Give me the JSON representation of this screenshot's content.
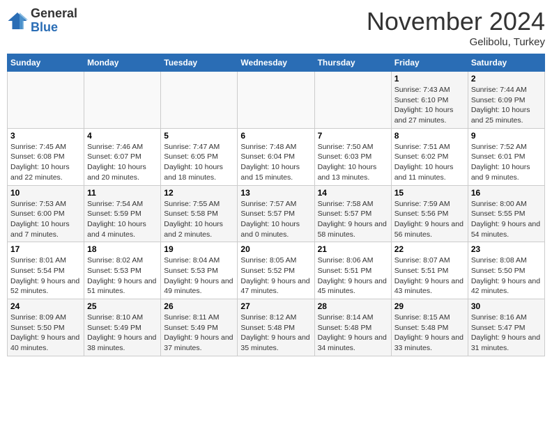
{
  "header": {
    "logo_line1": "General",
    "logo_line2": "Blue",
    "month": "November 2024",
    "location": "Gelibolu, Turkey"
  },
  "weekdays": [
    "Sunday",
    "Monday",
    "Tuesday",
    "Wednesday",
    "Thursday",
    "Friday",
    "Saturday"
  ],
  "weeks": [
    [
      {
        "day": "",
        "info": ""
      },
      {
        "day": "",
        "info": ""
      },
      {
        "day": "",
        "info": ""
      },
      {
        "day": "",
        "info": ""
      },
      {
        "day": "",
        "info": ""
      },
      {
        "day": "1",
        "info": "Sunrise: 7:43 AM\nSunset: 6:10 PM\nDaylight: 10 hours and 27 minutes."
      },
      {
        "day": "2",
        "info": "Sunrise: 7:44 AM\nSunset: 6:09 PM\nDaylight: 10 hours and 25 minutes."
      }
    ],
    [
      {
        "day": "3",
        "info": "Sunrise: 7:45 AM\nSunset: 6:08 PM\nDaylight: 10 hours and 22 minutes."
      },
      {
        "day": "4",
        "info": "Sunrise: 7:46 AM\nSunset: 6:07 PM\nDaylight: 10 hours and 20 minutes."
      },
      {
        "day": "5",
        "info": "Sunrise: 7:47 AM\nSunset: 6:05 PM\nDaylight: 10 hours and 18 minutes."
      },
      {
        "day": "6",
        "info": "Sunrise: 7:48 AM\nSunset: 6:04 PM\nDaylight: 10 hours and 15 minutes."
      },
      {
        "day": "7",
        "info": "Sunrise: 7:50 AM\nSunset: 6:03 PM\nDaylight: 10 hours and 13 minutes."
      },
      {
        "day": "8",
        "info": "Sunrise: 7:51 AM\nSunset: 6:02 PM\nDaylight: 10 hours and 11 minutes."
      },
      {
        "day": "9",
        "info": "Sunrise: 7:52 AM\nSunset: 6:01 PM\nDaylight: 10 hours and 9 minutes."
      }
    ],
    [
      {
        "day": "10",
        "info": "Sunrise: 7:53 AM\nSunset: 6:00 PM\nDaylight: 10 hours and 7 minutes."
      },
      {
        "day": "11",
        "info": "Sunrise: 7:54 AM\nSunset: 5:59 PM\nDaylight: 10 hours and 4 minutes."
      },
      {
        "day": "12",
        "info": "Sunrise: 7:55 AM\nSunset: 5:58 PM\nDaylight: 10 hours and 2 minutes."
      },
      {
        "day": "13",
        "info": "Sunrise: 7:57 AM\nSunset: 5:57 PM\nDaylight: 10 hours and 0 minutes."
      },
      {
        "day": "14",
        "info": "Sunrise: 7:58 AM\nSunset: 5:57 PM\nDaylight: 9 hours and 58 minutes."
      },
      {
        "day": "15",
        "info": "Sunrise: 7:59 AM\nSunset: 5:56 PM\nDaylight: 9 hours and 56 minutes."
      },
      {
        "day": "16",
        "info": "Sunrise: 8:00 AM\nSunset: 5:55 PM\nDaylight: 9 hours and 54 minutes."
      }
    ],
    [
      {
        "day": "17",
        "info": "Sunrise: 8:01 AM\nSunset: 5:54 PM\nDaylight: 9 hours and 52 minutes."
      },
      {
        "day": "18",
        "info": "Sunrise: 8:02 AM\nSunset: 5:53 PM\nDaylight: 9 hours and 51 minutes."
      },
      {
        "day": "19",
        "info": "Sunrise: 8:04 AM\nSunset: 5:53 PM\nDaylight: 9 hours and 49 minutes."
      },
      {
        "day": "20",
        "info": "Sunrise: 8:05 AM\nSunset: 5:52 PM\nDaylight: 9 hours and 47 minutes."
      },
      {
        "day": "21",
        "info": "Sunrise: 8:06 AM\nSunset: 5:51 PM\nDaylight: 9 hours and 45 minutes."
      },
      {
        "day": "22",
        "info": "Sunrise: 8:07 AM\nSunset: 5:51 PM\nDaylight: 9 hours and 43 minutes."
      },
      {
        "day": "23",
        "info": "Sunrise: 8:08 AM\nSunset: 5:50 PM\nDaylight: 9 hours and 42 minutes."
      }
    ],
    [
      {
        "day": "24",
        "info": "Sunrise: 8:09 AM\nSunset: 5:50 PM\nDaylight: 9 hours and 40 minutes."
      },
      {
        "day": "25",
        "info": "Sunrise: 8:10 AM\nSunset: 5:49 PM\nDaylight: 9 hours and 38 minutes."
      },
      {
        "day": "26",
        "info": "Sunrise: 8:11 AM\nSunset: 5:49 PM\nDaylight: 9 hours and 37 minutes."
      },
      {
        "day": "27",
        "info": "Sunrise: 8:12 AM\nSunset: 5:48 PM\nDaylight: 9 hours and 35 minutes."
      },
      {
        "day": "28",
        "info": "Sunrise: 8:14 AM\nSunset: 5:48 PM\nDaylight: 9 hours and 34 minutes."
      },
      {
        "day": "29",
        "info": "Sunrise: 8:15 AM\nSunset: 5:48 PM\nDaylight: 9 hours and 33 minutes."
      },
      {
        "day": "30",
        "info": "Sunrise: 8:16 AM\nSunset: 5:47 PM\nDaylight: 9 hours and 31 minutes."
      }
    ]
  ]
}
